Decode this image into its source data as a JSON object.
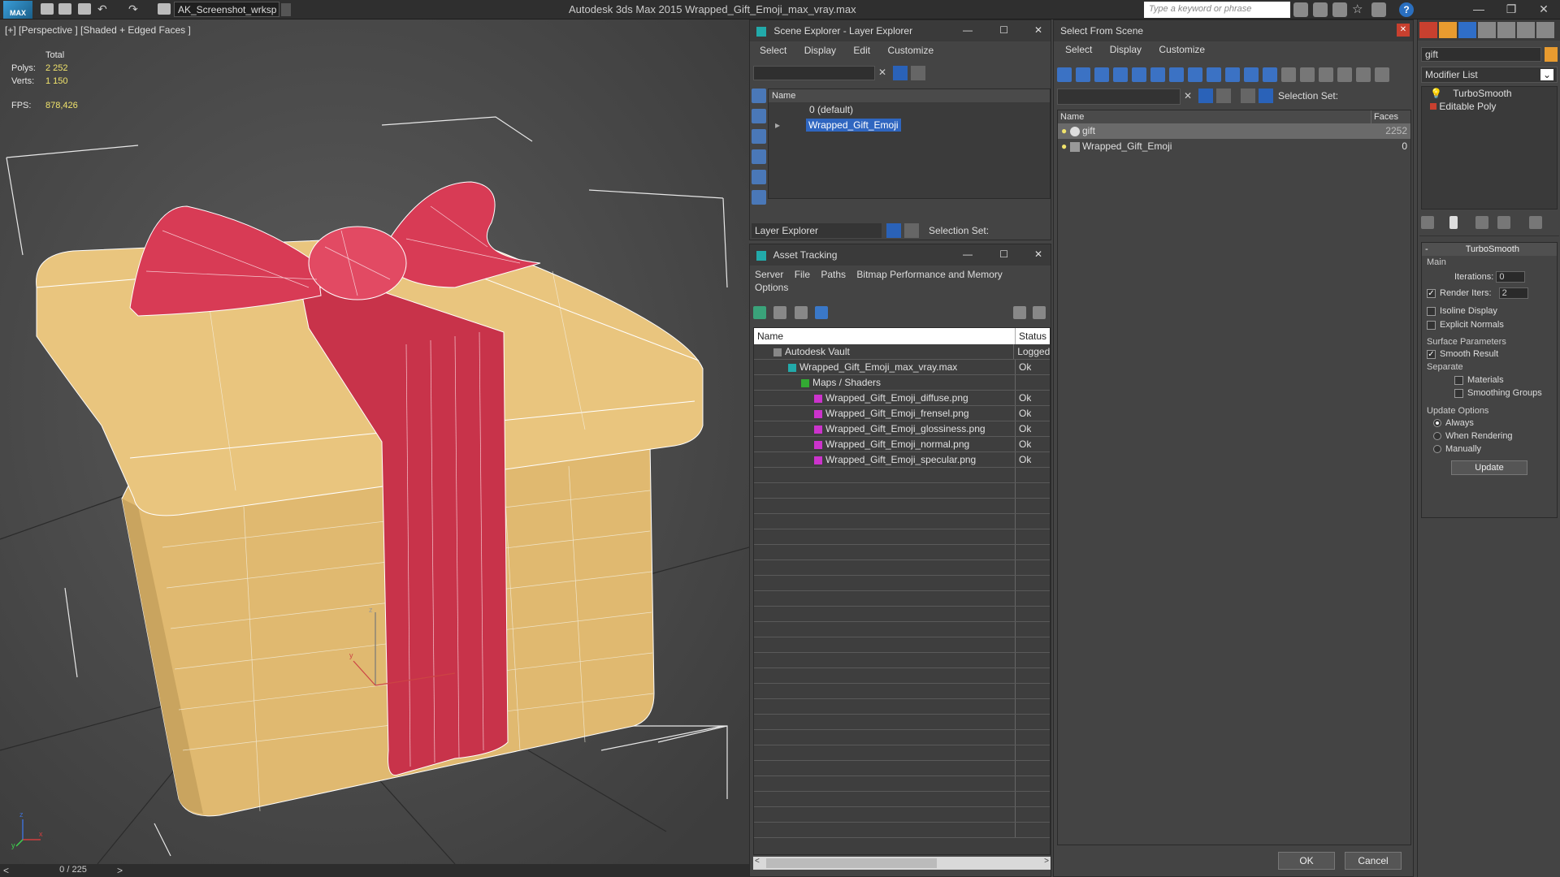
{
  "app": {
    "logo": "MAX",
    "workspace": "AK_Screenshot_wrksp",
    "title": "Autodesk 3ds Max  2015    Wrapped_Gift_Emoji_max_vray.max",
    "search_placeholder": "Type a keyword or phrase"
  },
  "viewport": {
    "label": "[+] [Perspective ] [Shaded + Edged Faces ]",
    "total_label": "Total",
    "polys_label": "Polys:",
    "polys": "2 252",
    "verts_label": "Verts:",
    "verts": "1 150",
    "fps_label": "FPS:",
    "fps": "878,426",
    "frame": "0 / 225",
    "axis_x": "x",
    "axis_y": "y",
    "axis_z": "z"
  },
  "scene_explorer": {
    "title": "Scene Explorer - Layer Explorer",
    "menu": [
      "Select",
      "Display",
      "Edit",
      "Customize"
    ],
    "col_name": "Name",
    "layers": [
      "0 (default)",
      "Wrapped_Gift_Emoji"
    ],
    "footer_dropdown": "Layer Explorer",
    "selection_set": "Selection Set:"
  },
  "asset_tracking": {
    "title": "Asset Tracking",
    "menu": [
      "Server",
      "File",
      "Paths",
      "Bitmap Performance and Memory"
    ],
    "menu2": "Options",
    "col_name": "Name",
    "col_status": "Status",
    "rows": [
      {
        "name": "Autodesk Vault",
        "status": "Logged"
      },
      {
        "name": "Wrapped_Gift_Emoji_max_vray.max",
        "status": "Ok"
      },
      {
        "name": "Maps / Shaders",
        "status": ""
      },
      {
        "name": "Wrapped_Gift_Emoji_diffuse.png",
        "status": "Ok"
      },
      {
        "name": "Wrapped_Gift_Emoji_frensel.png",
        "status": "Ok"
      },
      {
        "name": "Wrapped_Gift_Emoji_glossiness.png",
        "status": "Ok"
      },
      {
        "name": "Wrapped_Gift_Emoji_normal.png",
        "status": "Ok"
      },
      {
        "name": "Wrapped_Gift_Emoji_specular.png",
        "status": "Ok"
      }
    ]
  },
  "select_from_scene": {
    "title": "Select From Scene",
    "menu": [
      "Select",
      "Display",
      "Customize"
    ],
    "selection_set": "Selection Set:",
    "col_name": "Name",
    "col_faces": "Faces",
    "rows": [
      {
        "name": "gift",
        "faces": "2252"
      },
      {
        "name": "Wrapped_Gift_Emoji",
        "faces": "0"
      }
    ],
    "ok": "OK",
    "cancel": "Cancel"
  },
  "command_panel": {
    "object_name": "gift",
    "modifier_list": "Modifier List",
    "stack": [
      "TurboSmooth",
      "Editable Poly"
    ],
    "rollout_title": "TurboSmooth",
    "main_label": "Main",
    "iterations_label": "Iterations:",
    "iterations": "0",
    "render_iters_label": "Render Iters:",
    "render_iters": "2",
    "isoline": "Isoline Display",
    "explicit_normals": "Explicit Normals",
    "surface_params": "Surface Parameters",
    "smooth_result": "Smooth Result",
    "separate": "Separate",
    "materials": "Materials",
    "smoothing_groups": "Smoothing Groups",
    "update_options": "Update Options",
    "always": "Always",
    "when_rendering": "When Rendering",
    "manually": "Manually",
    "update_btn": "Update"
  }
}
